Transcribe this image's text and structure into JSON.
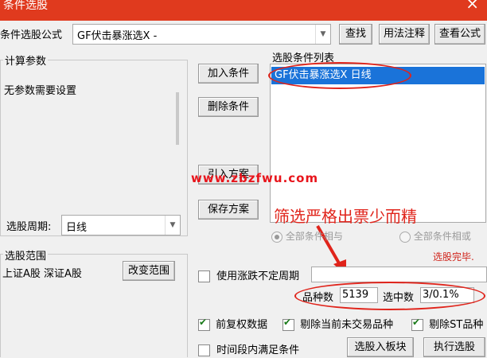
{
  "window": {
    "title": "条件选股",
    "close_icon": "×"
  },
  "formula": {
    "label": "条件选股公式",
    "value": "GF伏击暴涨选X  -",
    "find_btn": "查找",
    "usage_btn": "用法注释",
    "view_btn": "查看公式"
  },
  "params": {
    "title": "计算参数",
    "text": "无参数需要设置"
  },
  "period": {
    "label": "选股周期:",
    "value": "日线"
  },
  "range": {
    "title": "选股范围",
    "value": "上证A股 深证A股",
    "change_btn": "改变范围"
  },
  "buttons": {
    "add": "加入条件",
    "delete": "删除条件",
    "import": "引入方案",
    "save": "保存方案"
  },
  "cond_list": {
    "title": "选股条件列表",
    "items": [
      "GF伏击暴涨选X  日线"
    ]
  },
  "watermark": "www.zbzfwu.com",
  "annotation": "筛选严格出票少而精",
  "logic": {
    "all_and": "全部条件相与",
    "all_or": "全部条件相或"
  },
  "status": "选股完毕.",
  "uncertain": {
    "label": "使用涨跌不定周期"
  },
  "stats": {
    "count_label": "品种数",
    "count_value": "5139",
    "selected_label": "选中数",
    "selected_value": "3/0.1%"
  },
  "options": {
    "rights": "前复权数据",
    "exclude_untraded": "剔除当前未交易品种",
    "exclude_st": "剔除ST品种",
    "time_range": "时间段内满足条件"
  },
  "actions": {
    "to_block": "选股入板块",
    "execute": "执行选股"
  },
  "colors": {
    "title_bar": "#e03a1e",
    "selection": "#1a73d9",
    "annotation": "#e0241b",
    "status": "#d0241b"
  }
}
